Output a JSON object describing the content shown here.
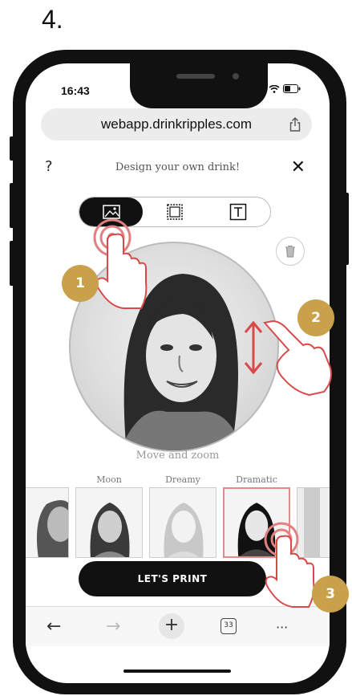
{
  "step_label": "4.",
  "status_bar": {
    "time": "16:43"
  },
  "browser": {
    "url": "webapp.drinkripples.com"
  },
  "header": {
    "help": "?",
    "title": "Design your own drink!",
    "close": "✕"
  },
  "tabs": [
    {
      "icon": "image-icon",
      "active": true
    },
    {
      "icon": "frame-icon",
      "active": false
    },
    {
      "icon": "text-icon",
      "active": false
    }
  ],
  "canvas": {
    "hint": "Move and zoom"
  },
  "filters": [
    {
      "label": "y",
      "selected": false
    },
    {
      "label": "Moon",
      "selected": false
    },
    {
      "label": "Dreamy",
      "selected": false
    },
    {
      "label": "Dramatic",
      "selected": true
    }
  ],
  "print_button": "LET'S PRINT",
  "toolbar": {
    "back": "←",
    "forward": "→",
    "new_tab": "+",
    "tabs_count": "33",
    "more": "···"
  },
  "callouts": [
    "1",
    "2",
    "3"
  ],
  "colors": {
    "badge": "#c9a14a",
    "accent": "#e28a8a",
    "button": "#111111"
  }
}
